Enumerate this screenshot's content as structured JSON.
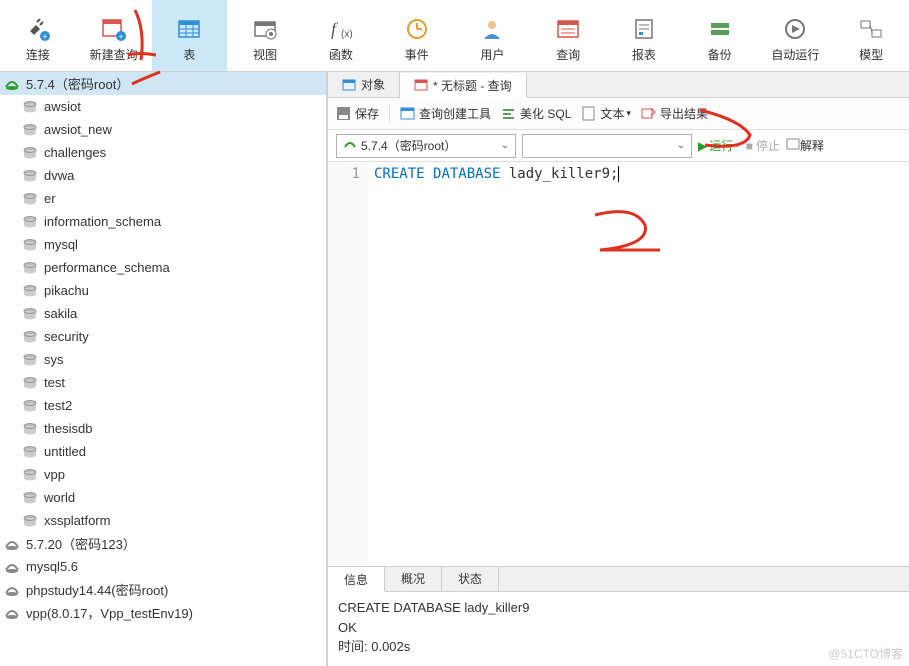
{
  "toolbar": [
    {
      "label": "连接",
      "name": "connection",
      "icon": "plug"
    },
    {
      "label": "新建查询",
      "name": "new-query",
      "icon": "new-query"
    },
    {
      "label": "表",
      "name": "table",
      "icon": "table",
      "active": true
    },
    {
      "label": "视图",
      "name": "view",
      "icon": "view"
    },
    {
      "label": "函数",
      "name": "function",
      "icon": "fx"
    },
    {
      "label": "事件",
      "name": "event",
      "icon": "clock"
    },
    {
      "label": "用户",
      "name": "user",
      "icon": "user"
    },
    {
      "label": "查询",
      "name": "query",
      "icon": "query"
    },
    {
      "label": "报表",
      "name": "report",
      "icon": "report"
    },
    {
      "label": "备份",
      "name": "backup",
      "icon": "backup"
    },
    {
      "label": "自动运行",
      "name": "autorun",
      "icon": "autorun"
    },
    {
      "label": "模型",
      "name": "model",
      "icon": "model"
    }
  ],
  "connections": [
    {
      "name": "5.7.4（密码root）",
      "selected": true,
      "open": true,
      "databases": [
        "awsiot",
        "awsiot_new",
        "challenges",
        "dvwa",
        "er",
        "information_schema",
        "mysql",
        "performance_schema",
        "pikachu",
        "sakila",
        "security",
        "sys",
        "test",
        "test2",
        "thesisdb",
        "untitled",
        "vpp",
        "world",
        "xssplatform"
      ]
    },
    {
      "name": "5.7.20（密码123）",
      "open": false
    },
    {
      "name": "mysql5.6",
      "open": false
    },
    {
      "name": "phpstudy14.44(密码root)",
      "open": false
    },
    {
      "name": "vpp(8.0.17，Vpp_testEnv19)",
      "open": false
    }
  ],
  "tabs": [
    {
      "label": "对象",
      "icon": "table",
      "active": false
    },
    {
      "label": "* 无标题 - 查询",
      "icon": "query",
      "active": true
    }
  ],
  "query_toolbar": {
    "save": "保存",
    "builder": "查询创建工具",
    "beautify": "美化 SQL",
    "text": "文本",
    "export": "导出结果"
  },
  "conn_select": {
    "value": "5.7.4（密码root）"
  },
  "db_select": {
    "value": ""
  },
  "run_btn": "运行",
  "stop_btn": "停止",
  "explain_btn": "解释",
  "editor": {
    "line_no": "1",
    "kw1": "CREATE",
    "kw2": "DATABASE",
    "rest": " lady_killer9;"
  },
  "out_tabs": [
    "信息",
    "概况",
    "状态"
  ],
  "output": {
    "line1": "CREATE DATABASE lady_killer9",
    "line2": "OK",
    "line3": "时间: 0.002s"
  },
  "watermark": "@51CTO博客",
  "colors": {
    "accent": "#2f8fd8",
    "run": "#2a9d2a"
  }
}
